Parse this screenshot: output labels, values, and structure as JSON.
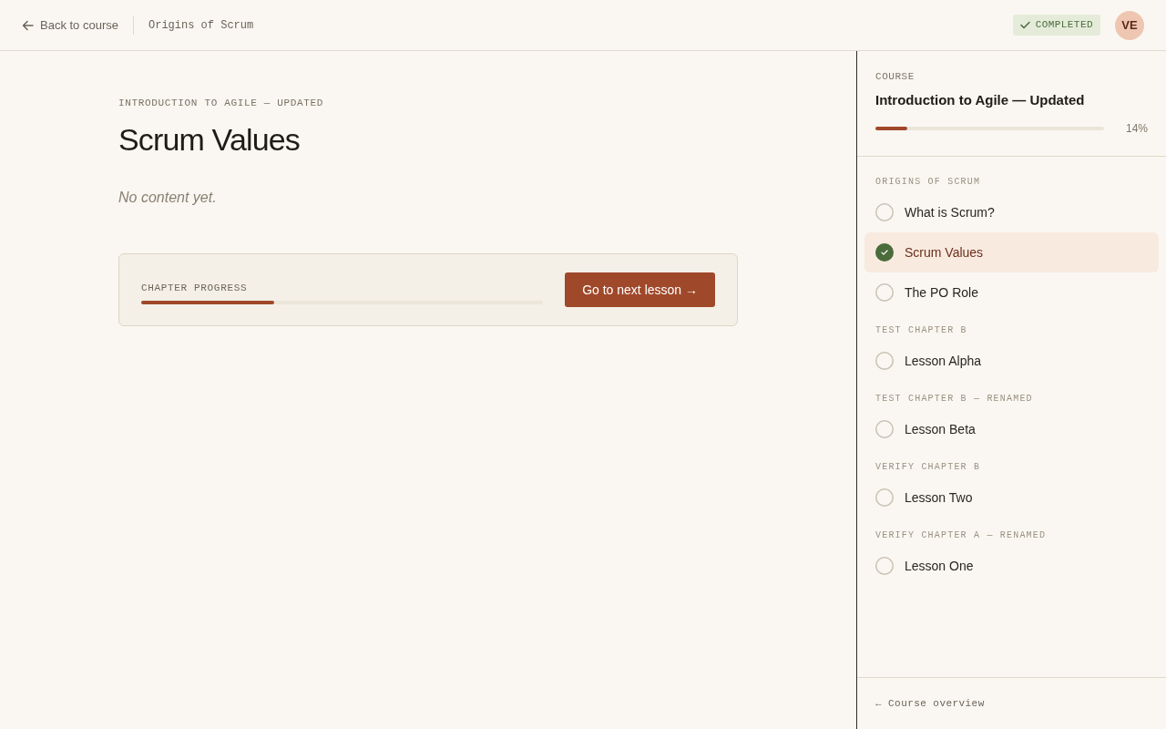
{
  "header": {
    "back_link": "Back to course",
    "breadcrumb": "Origins of Scrum",
    "status_badge": "COMPLETED",
    "avatar_initials": "VE"
  },
  "lesson": {
    "course_eyebrow": "INTRODUCTION TO AGILE — UPDATED",
    "title": "Scrum Values",
    "body": "No content yet.",
    "chapter_progress": {
      "label": "CHAPTER PROGRESS",
      "level": 0.33
    },
    "next_button": "Go to next lesson →"
  },
  "sidebar": {
    "eyebrow": "COURSE",
    "course_title": "Introduction to Agile — Updated",
    "progress": {
      "level": 0.14,
      "reading": "14%"
    },
    "chapters": [
      {
        "title": "ORIGINS OF SCRUM",
        "lessons": [
          {
            "title": "What is Scrum?",
            "completed": false,
            "selected": false
          },
          {
            "title": "Scrum Values",
            "completed": true,
            "selected": true
          },
          {
            "title": "The PO Role",
            "completed": false,
            "selected": false
          }
        ]
      },
      {
        "title": "TEST CHAPTER B",
        "lessons": [
          {
            "title": "Lesson Alpha",
            "completed": false,
            "selected": false
          }
        ]
      },
      {
        "title": "TEST CHAPTER B — RENAMED",
        "lessons": [
          {
            "title": "Lesson Beta",
            "completed": false,
            "selected": false
          }
        ]
      },
      {
        "title": "VERIFY CHAPTER B",
        "lessons": [
          {
            "title": "Lesson Two",
            "completed": false,
            "selected": false
          }
        ]
      },
      {
        "title": "VERIFY CHAPTER A — RENAMED",
        "lessons": [
          {
            "title": "Lesson One",
            "completed": false,
            "selected": false
          }
        ]
      }
    ],
    "footer_link": "← Course overview"
  }
}
